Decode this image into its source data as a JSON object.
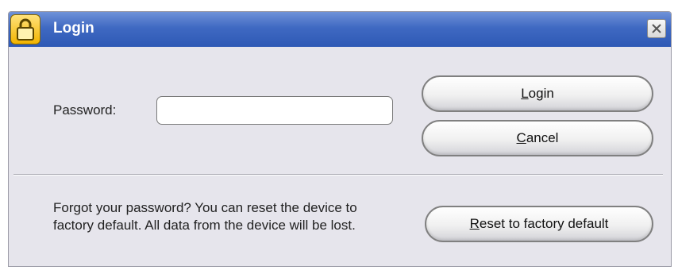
{
  "window": {
    "title": "Login"
  },
  "form": {
    "password_label": "Password:",
    "password_value": "",
    "password_placeholder": ""
  },
  "buttons": {
    "login": {
      "mnemonic": "L",
      "rest": "ogin"
    },
    "cancel": {
      "mnemonic": "C",
      "rest": "ancel"
    },
    "reset": {
      "mnemonic": "R",
      "rest": "eset to factory default"
    }
  },
  "reset_section": {
    "message": "Forgot your password? You can reset the device to factory default. All data from the device will be lost."
  },
  "icons": {
    "window_icon": "lock-icon",
    "close": "close-icon"
  },
  "colors": {
    "titlebar": "#3f69c2",
    "dialog_bg": "#e6e5ec",
    "lock": "#f2b400"
  }
}
